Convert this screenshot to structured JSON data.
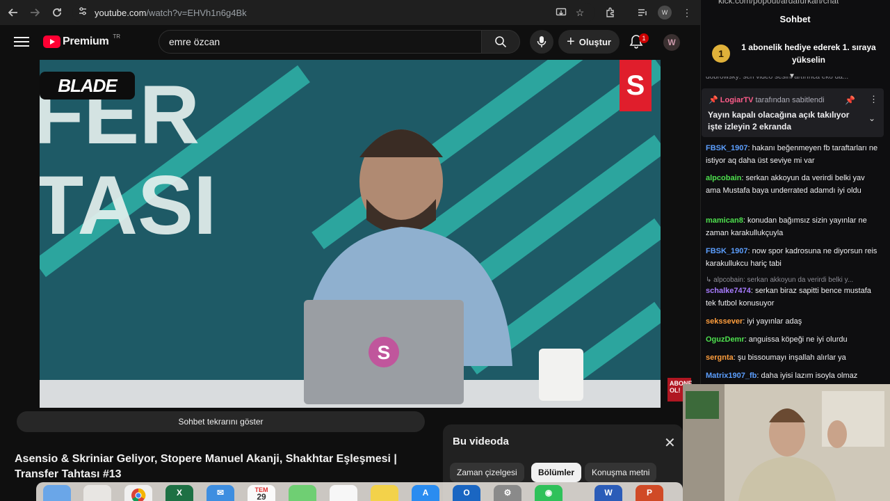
{
  "browser": {
    "url_host": "youtube.com",
    "url_path": "/watch?v=EHVh1n6g4Bk"
  },
  "yt": {
    "logo_text": "Premium",
    "logo_region": "TR",
    "search_value": "emre özcan",
    "create_label": "Oluştur",
    "notif_count": "1",
    "video_overlay_brand": "BLADE",
    "video_badge": "S",
    "video_corner_badge": "ABONE OL!",
    "video_bg_text": "FER TASI",
    "laptop_logo": "S",
    "chat_replay_label": "Sohbet tekrarını göster",
    "video_title": "Asensio & Skriniar Geliyor, Stopere Manuel Akanji, Shakhtar Eşleşmesi | Transfer Tahtası #13"
  },
  "bu_videoda": {
    "title": "Bu videoda",
    "chips": [
      "Zaman çizelgesi",
      "Bölümler",
      "Konuşma metni"
    ]
  },
  "dock": {
    "calendar_month": "TEM",
    "calendar_day": "29"
  },
  "chat": {
    "kick_url": "kick.com/popout/ardafurkan/chat",
    "header": "Sohbet",
    "gift_banner": "1 abonelik hediye ederek 1. sıraya yükselin",
    "gift_rank": "1",
    "truncated_top": "dobrowsky: sen video sesini artırınca eko da...",
    "pinned_by": "LogiarTV",
    "pinned_suffix": "tarafından sabitlendi",
    "pinned_message": "Yayın kapalı olacağına açık takılıyor işte izleyin 2 ekranda",
    "messages": [
      {
        "user": "FBSK_1907",
        "text": "hakanı beğenmeyen fb taraftarları ne istiyor aq daha üst seviye mi var",
        "color": "#5c9fff"
      },
      {
        "user": "alpcobain",
        "text": "serkan akkoyun da verirdi belki yav ama Mustafa baya underrated adamdı iyi oldu",
        "color": "#4ee04e"
      },
      {
        "user": "mamican8",
        "text": "konudan bağımsız sizin yayınlar ne zaman karakullukçuyla",
        "color": "#4ee04e"
      },
      {
        "user": "FBSK_1907",
        "text": "now spor kadrosuna ne diyorsun reis karakullukcu hariç tabi",
        "color": "#5c9fff"
      },
      {
        "user": "schalke7474",
        "text": "serkan biraz sapitti bence mustafa tek futbol konusuyor",
        "color": "#a87cff",
        "reply_to": "alpcobain: serkan akkoyun da verirdi belki y..."
      },
      {
        "user": "sekssever",
        "text": "iyi yayınlar adaş",
        "color": "#ff9e3d"
      },
      {
        "user": "OguzDemr",
        "text": "anguissa köpeği ne iyi olurdu",
        "color": "#4ee04e"
      },
      {
        "user": "sergnta",
        "text": "şu bissoumayı inşallah alırlar ya",
        "color": "#ff9e3d"
      },
      {
        "user": "Matrix1907_fb",
        "text": "daha iyisi lazım isoyla olmaz",
        "color": "#5c9fff"
      }
    ]
  }
}
